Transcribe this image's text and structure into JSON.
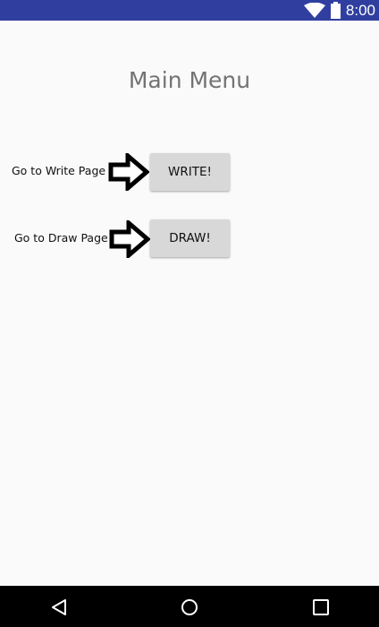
{
  "status_bar": {
    "time": "8:00",
    "icons": [
      "wifi-icon",
      "battery-icon"
    ],
    "color": "#303f9f"
  },
  "main": {
    "title": "Main Menu",
    "rows": [
      {
        "label": "Go to Write Page",
        "button_label": "WRITE!"
      },
      {
        "label": "Go to Draw Page",
        "button_label": "DRAW!"
      }
    ]
  },
  "nav_bar": {
    "icons": [
      "back-icon",
      "home-icon",
      "recents-icon"
    ]
  }
}
